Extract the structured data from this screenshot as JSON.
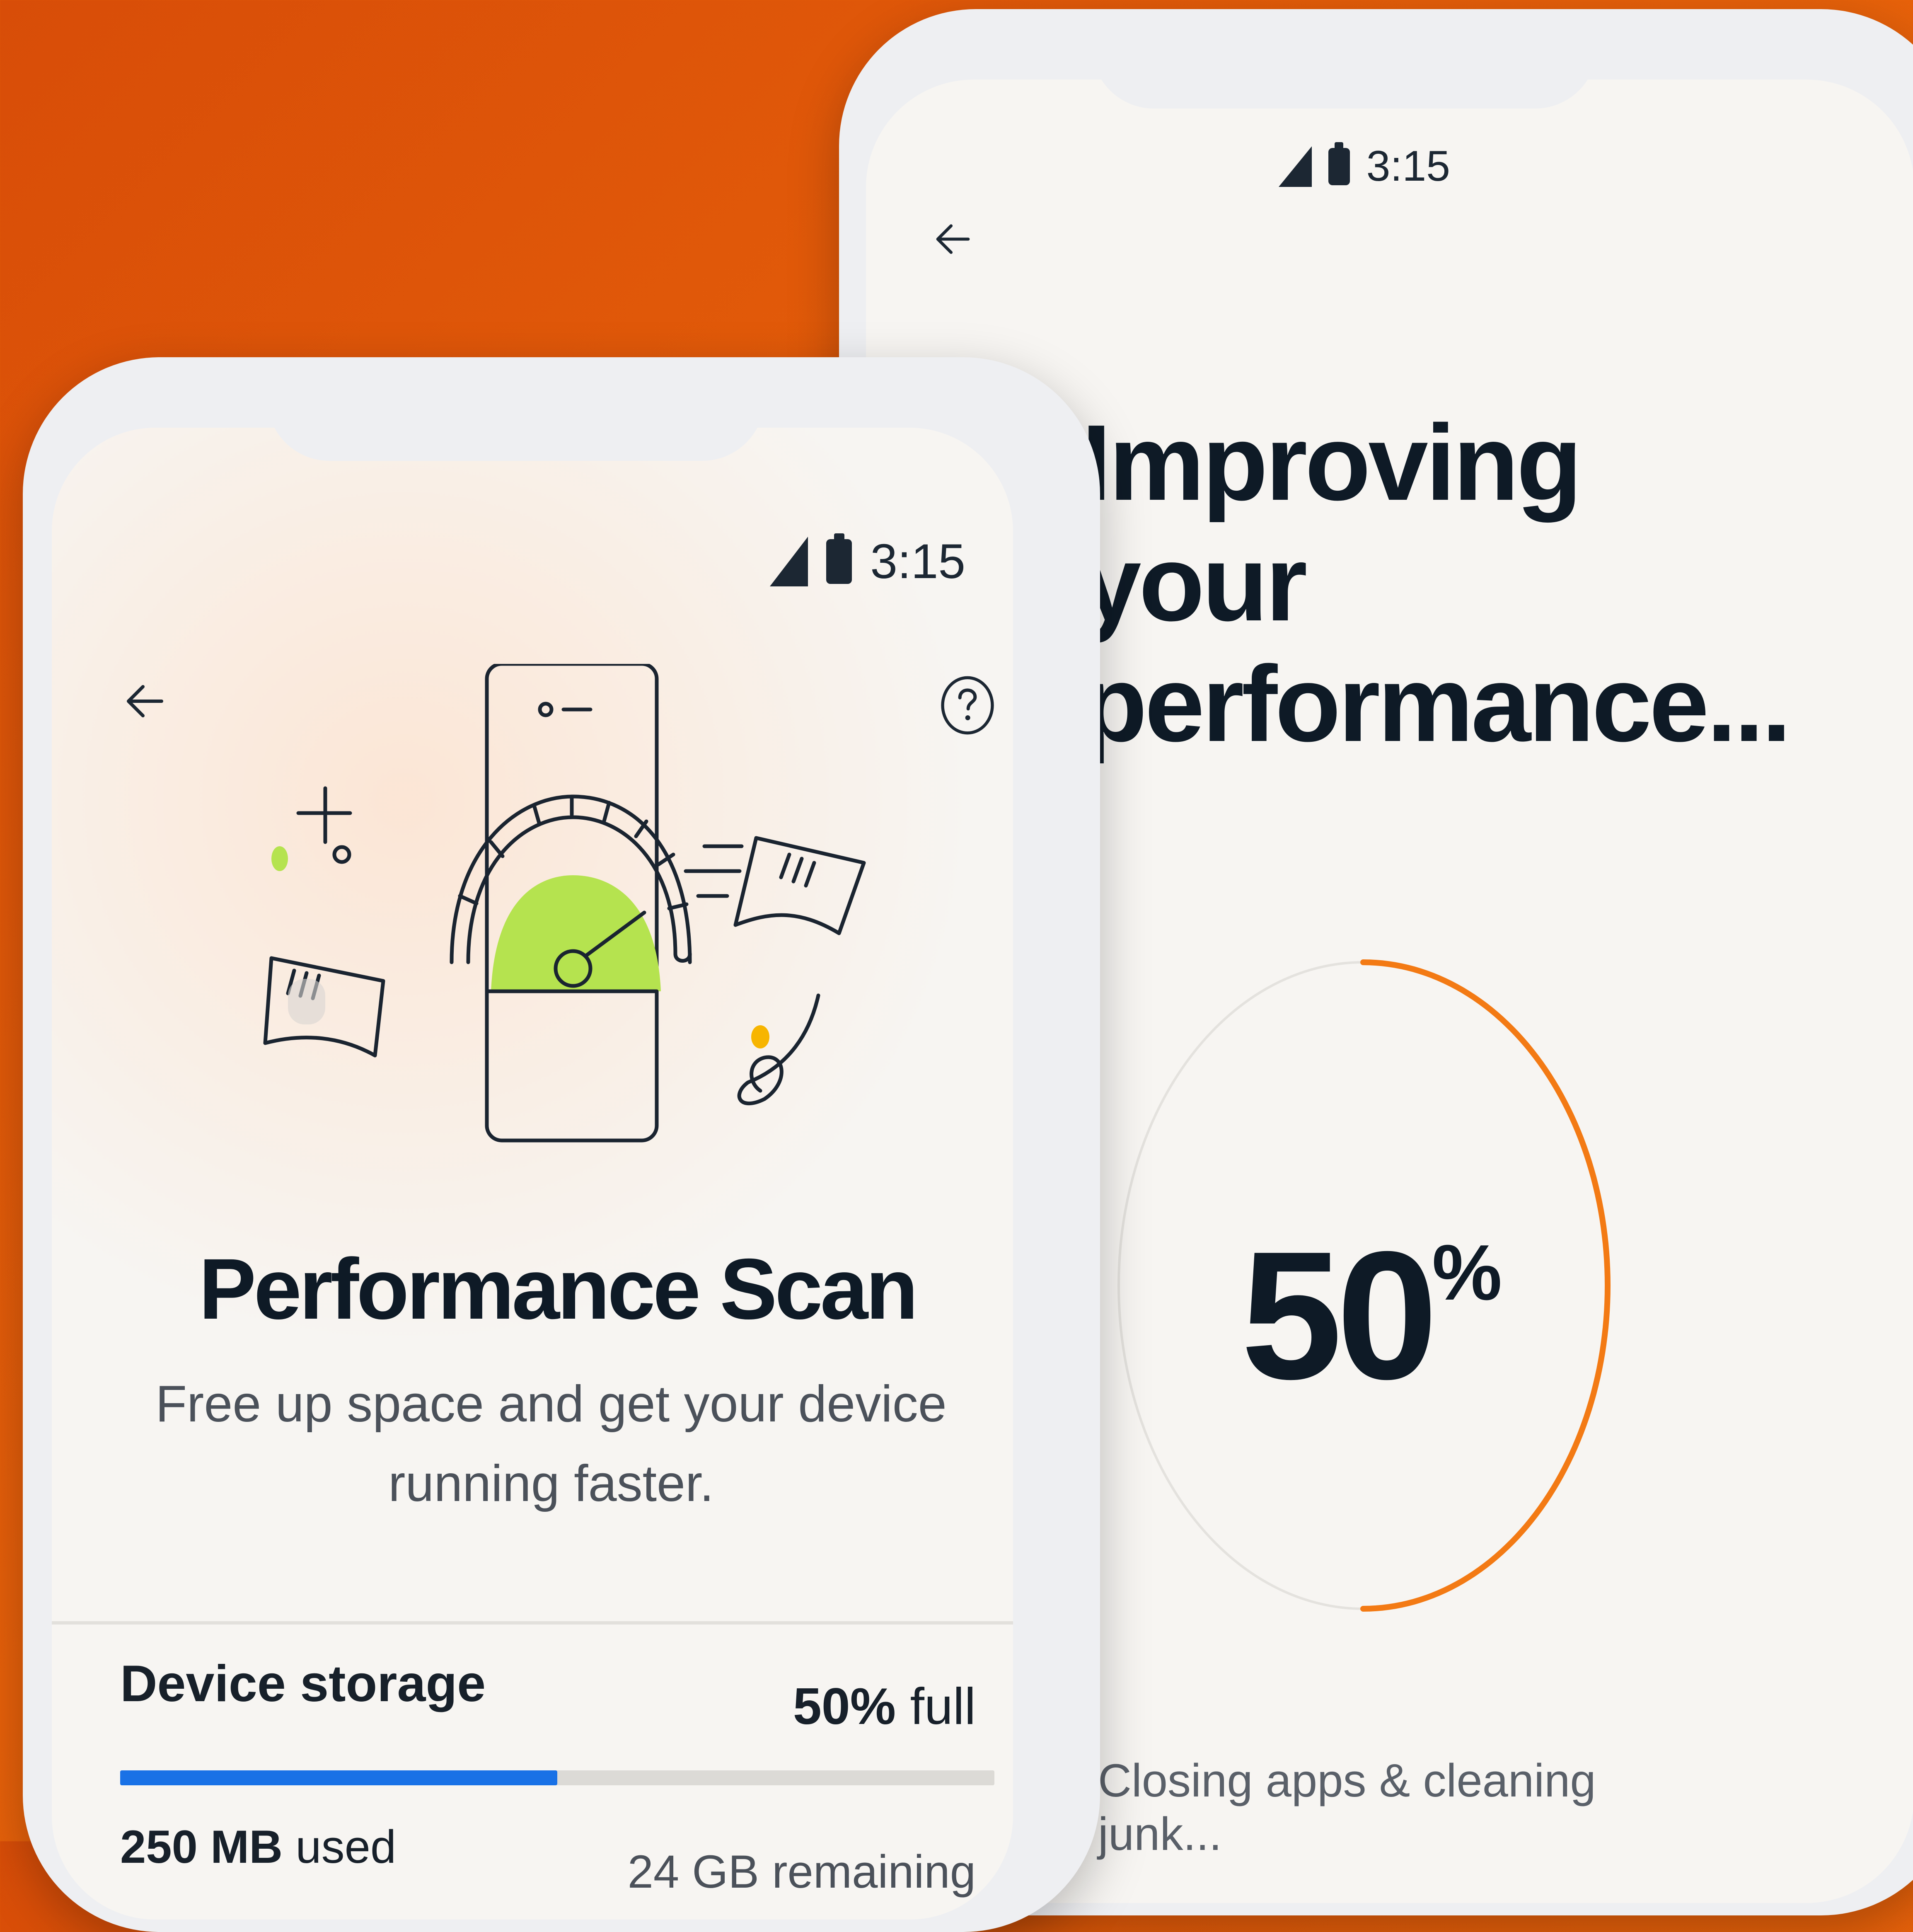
{
  "back_screen": {
    "status_time": "3:15",
    "title_line1": "Improving your",
    "title_line2": "performance...",
    "progress": {
      "value": 0.5,
      "number": "50",
      "unit": "%"
    },
    "status_text": "Closing apps & cleaning junk...",
    "accent_color": "#f37a14"
  },
  "front_screen": {
    "status_time": "3:15",
    "title": "Performance Scan",
    "subtitle": "Free up space and get your device running faster.",
    "storage": {
      "label": "Device storage",
      "percent_value": "50%",
      "percent_suffix": "full",
      "fill_fraction": 0.5,
      "used_value": "250 MB",
      "used_suffix": "used",
      "remaining": "24 GB remaining",
      "bar_color": "#1971e6"
    },
    "icons": [
      "back-arrow-icon",
      "help-icon",
      "signal-icon",
      "battery-icon"
    ],
    "illustration_accent": "#b5e34f"
  },
  "background_color": "#e35c0a"
}
